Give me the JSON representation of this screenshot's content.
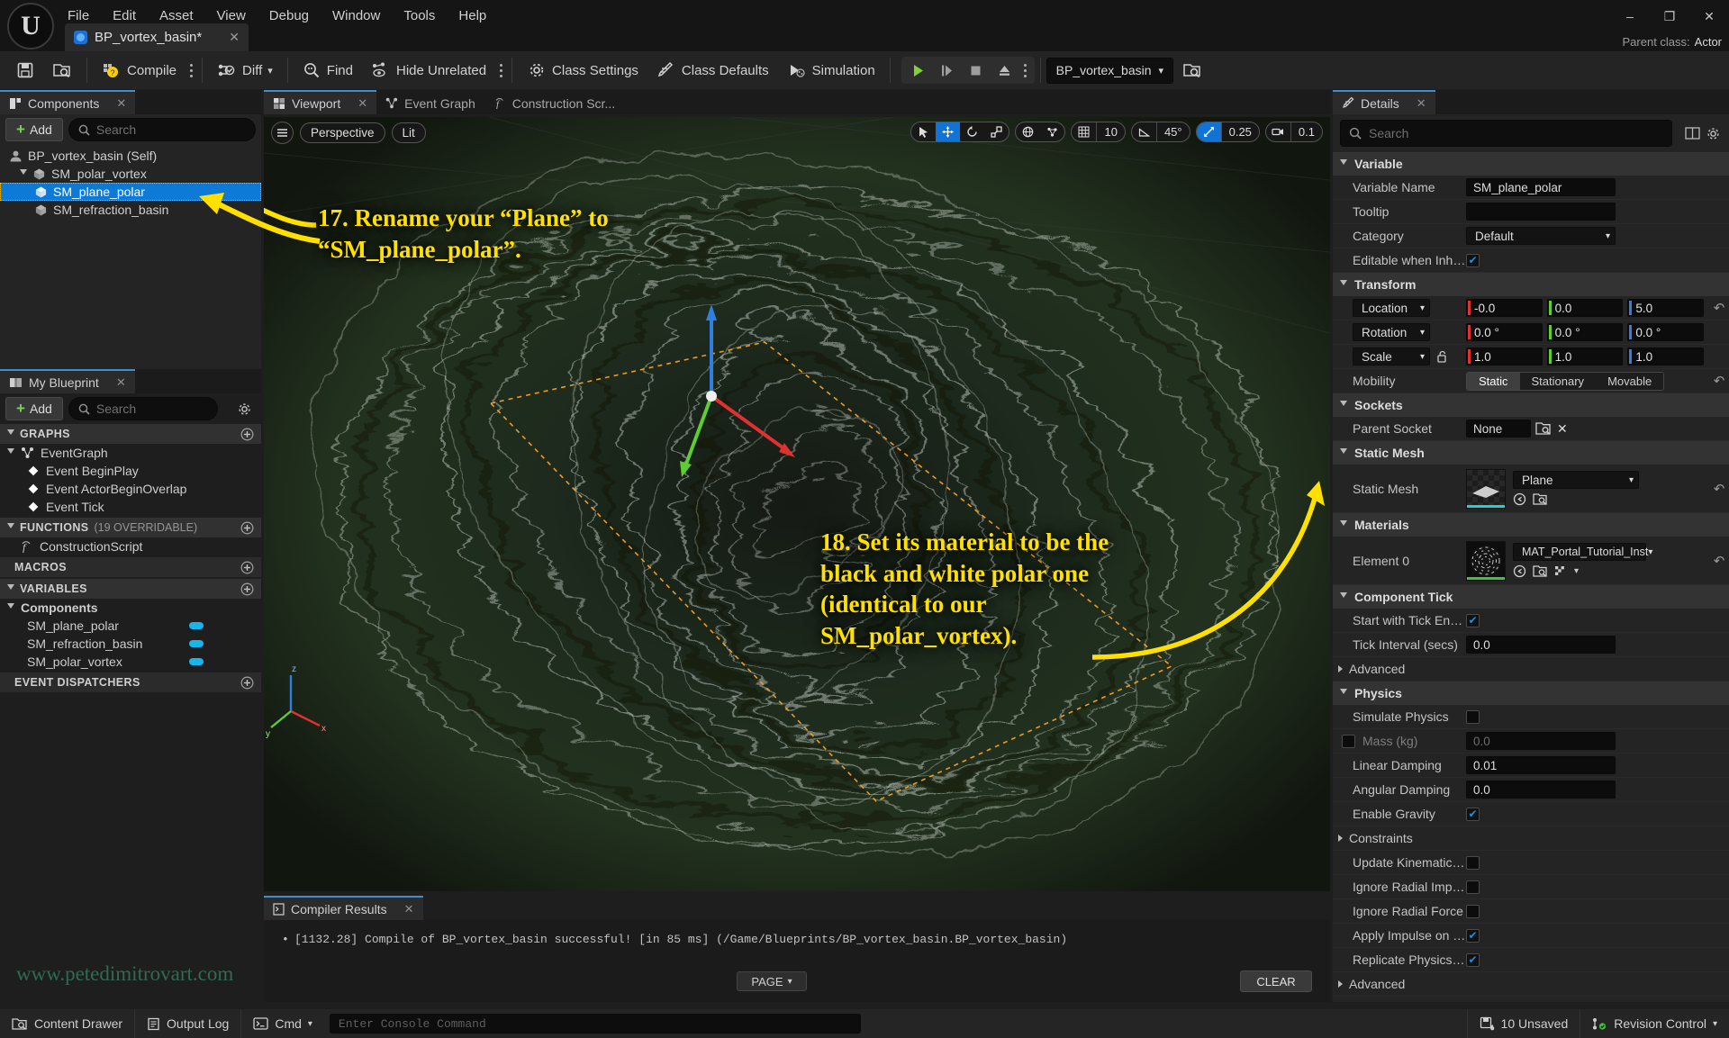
{
  "window": {
    "menu": [
      "File",
      "Edit",
      "Asset",
      "View",
      "Debug",
      "Window",
      "Tools",
      "Help"
    ],
    "asset_tab": "BP_vortex_basin*",
    "parent_class_label": "Parent class:",
    "parent_class_value": "Actor",
    "minimize": "–",
    "maximize": "❐",
    "close": "✕"
  },
  "toolbar": {
    "save": "save-icon",
    "browse": "browse-icon",
    "compile": "Compile",
    "diff": "Diff",
    "find": "Find",
    "hide_unrelated": "Hide Unrelated",
    "class_settings": "Class Settings",
    "class_defaults": "Class Defaults",
    "simulation": "Simulation",
    "blueprint_combo": "BP_vortex_basin"
  },
  "components": {
    "tab_title": "Components",
    "add_label": "Add",
    "search_placeholder": "Search",
    "tree": [
      {
        "label": "BP_vortex_basin (Self)",
        "indent": 0,
        "icon": "actor-icon",
        "selected": false,
        "expander": "none"
      },
      {
        "label": "SM_polar_vortex",
        "indent": 1,
        "icon": "mesh-icon",
        "selected": false,
        "expander": "open"
      },
      {
        "label": "SM_plane_polar",
        "indent": 2,
        "icon": "mesh-icon",
        "selected": true,
        "expander": "none"
      },
      {
        "label": "SM_refraction_basin",
        "indent": 2,
        "icon": "mesh-icon",
        "selected": false,
        "expander": "none"
      }
    ]
  },
  "my_blueprint": {
    "tab_title": "My Blueprint",
    "add_label": "Add",
    "search_placeholder": "Search",
    "settings_icon": "gear-icon",
    "sections": [
      {
        "title": "GRAPHS",
        "sub": "",
        "plus": true
      },
      {
        "title": "FUNCTIONS",
        "sub": "(19 OVERRIDABLE)",
        "plus": true
      },
      {
        "title": "MACROS",
        "sub": "",
        "plus": true
      },
      {
        "title": "VARIABLES",
        "sub": "",
        "plus": true
      },
      {
        "title": "EVENT DISPATCHERS",
        "sub": "",
        "plus": true
      }
    ],
    "graphs": [
      {
        "label": "EventGraph",
        "indent": 0,
        "icon": "graph-icon"
      },
      {
        "label": "Event BeginPlay",
        "indent": 1,
        "icon": "event-icon"
      },
      {
        "label": "Event ActorBeginOverlap",
        "indent": 1,
        "icon": "event-icon"
      },
      {
        "label": "Event Tick",
        "indent": 1,
        "icon": "event-icon"
      }
    ],
    "functions": [
      {
        "label": "ConstructionScript",
        "icon": "function-icon"
      }
    ],
    "variables_group": "Components",
    "variables": [
      {
        "label": "SM_plane_polar",
        "pill": "#17b5ea"
      },
      {
        "label": "SM_refraction_basin",
        "pill": "#17b5ea"
      },
      {
        "label": "SM_polar_vortex",
        "pill": "#17b5ea"
      }
    ]
  },
  "viewport": {
    "tabs": [
      {
        "label": "Viewport",
        "active": true,
        "icon": "viewport-icon",
        "closable": true
      },
      {
        "label": "Event Graph",
        "active": false,
        "icon": "graph-icon",
        "closable": false
      },
      {
        "label": "Construction Scr...",
        "active": false,
        "icon": "function-icon",
        "closable": false
      }
    ],
    "menu_icon": "hamburger-icon",
    "perspective": "Perspective",
    "lighting": "Lit",
    "grid_snap": "10",
    "angle_snap": "45°",
    "scale_snap": "0.25",
    "camera_speed": "0.1"
  },
  "callouts": [
    {
      "id": "callout-17",
      "text": "17. Rename your “Plane” to “SM_plane_polar”."
    },
    {
      "id": "callout-18",
      "text": "18. Set its material to be the black and white polar one (identical to our SM_polar_vortex)."
    }
  ],
  "compiler": {
    "tab_title": "Compiler Results",
    "message": "[1132.28] Compile of BP_vortex_basin successful! [in 85 ms] (/Game/Blueprints/BP_vortex_basin.BP_vortex_basin)",
    "page_label": "PAGE",
    "clear_label": "CLEAR"
  },
  "watermark": "www.petedimitrovart.com",
  "details": {
    "tab_title": "Details",
    "search_placeholder": "Search",
    "columns_icon": "columns-icon",
    "settings_icon": "gear-icon",
    "sections": {
      "variable": {
        "title": "Variable",
        "variable_name_label": "Variable Name",
        "variable_name_value": "SM_plane_polar",
        "tooltip_label": "Tooltip",
        "tooltip_value": "",
        "category_label": "Category",
        "category_value": "Default",
        "editable_label": "Editable when Inherited",
        "editable_checked": true
      },
      "transform": {
        "title": "Transform",
        "location_label": "Location",
        "location": [
          "-0.0",
          "0.0",
          "5.0"
        ],
        "rotation_label": "Rotation",
        "rotation": [
          "0.0 °",
          "0.0 °",
          "0.0 °"
        ],
        "scale_label": "Scale",
        "scale": [
          "1.0",
          "1.0",
          "1.0"
        ],
        "mobility_label": "Mobility",
        "mobility_options": [
          "Static",
          "Stationary",
          "Movable"
        ],
        "mobility_selected": "Static"
      },
      "sockets": {
        "title": "Sockets",
        "parent_socket_label": "Parent Socket",
        "parent_socket_value": "None"
      },
      "static_mesh": {
        "title": "Static Mesh",
        "row_label": "Static Mesh",
        "asset_value": "Plane",
        "accent": "#18d4d4"
      },
      "materials": {
        "title": "Materials",
        "row_label": "Element 0",
        "asset_value": "MAT_Portal_Tutorial_Inst",
        "accent": "#3fc23f"
      },
      "component_tick": {
        "title": "Component Tick",
        "start_tick_label": "Start with Tick Enabled",
        "start_tick_checked": true,
        "tick_interval_label": "Tick Interval (secs)",
        "tick_interval_value": "0.0",
        "advanced_label": "Advanced"
      },
      "physics": {
        "title": "Physics",
        "rows": [
          {
            "label": "Simulate Physics",
            "type": "checkbox",
            "checked": false
          },
          {
            "label": "Mass (kg)",
            "type": "text-disabled",
            "value": "0.0",
            "prefix_checkbox": true
          },
          {
            "label": "Linear Damping",
            "type": "text",
            "value": "0.01"
          },
          {
            "label": "Angular Damping",
            "type": "text",
            "value": "0.0"
          },
          {
            "label": "Enable Gravity",
            "type": "checkbox",
            "checked": true
          },
          {
            "label": "Constraints",
            "type": "group"
          },
          {
            "label": "Update Kinematic from Si…",
            "type": "checkbox",
            "checked": false
          },
          {
            "label": "Ignore Radial Impulse",
            "type": "checkbox",
            "checked": false
          },
          {
            "label": "Ignore Radial Force",
            "type": "checkbox",
            "checked": false
          },
          {
            "label": "Apply Impulse on Damage",
            "type": "checkbox",
            "checked": true
          },
          {
            "label": "Replicate Physics to Auton…",
            "type": "checkbox",
            "checked": true
          },
          {
            "label": "Advanced",
            "type": "group"
          }
        ]
      }
    }
  },
  "statusbar": {
    "content_drawer": "Content Drawer",
    "output_log": "Output Log",
    "cmd": "Cmd",
    "console_placeholder": "Enter Console Command",
    "unsaved": "10 Unsaved",
    "revision_control": "Revision Control"
  }
}
